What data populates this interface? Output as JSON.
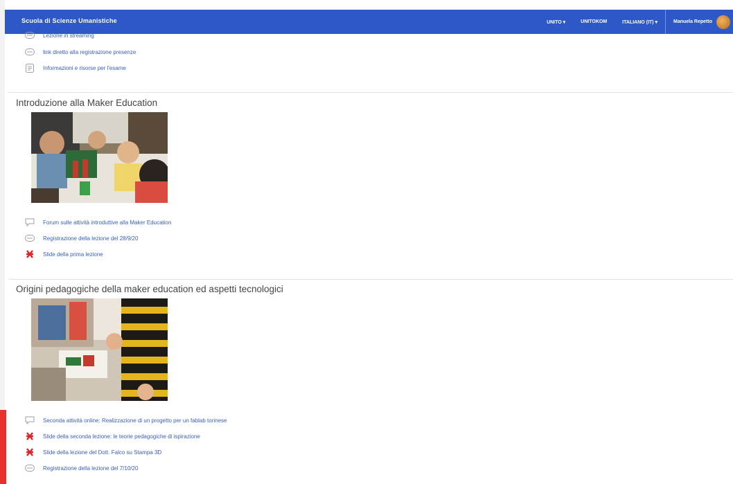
{
  "navbar": {
    "brand": "Scuola di Scienze Umanistiche",
    "menu": [
      {
        "label": "UNITO ▾"
      },
      {
        "label": "UNITOKOM"
      },
      {
        "label": "ITALIANO (IT) ▾"
      }
    ],
    "user_name": "Manuela Repetto"
  },
  "top_activities": [
    {
      "label": "Lezione in streaming",
      "icon": "url-icon"
    },
    {
      "label": "link diretto alla registrazione presenze",
      "icon": "url-icon"
    },
    {
      "label": "Informazioni e risorse per l'esame",
      "icon": "page-icon"
    }
  ],
  "sections": [
    {
      "title": "Introduzione alla Maker Education",
      "activities": [
        {
          "label": "Forum sulle attività introduttive alla Maker Education",
          "icon": "forum-icon"
        },
        {
          "label": "Registrazione della lezione del 28/9/20",
          "icon": "url-icon"
        },
        {
          "label": "Slide della prima lezione",
          "icon": "pdf-icon"
        }
      ]
    },
    {
      "title": "Origini pedagogiche della maker education ed aspetti tecnologici",
      "activities": [
        {
          "label": "Seconda attività online: Realizzazione di un progetto per un fablab torinese",
          "icon": "forum-icon"
        },
        {
          "label": "Slide della seconda lezione: le teorie pedagogiche di ispirazione",
          "icon": "pdf-icon"
        },
        {
          "label": "Slide della lezione del Dott. Falco su Stampa 3D",
          "icon": "pdf-icon"
        },
        {
          "label": "Registrazione della lezione del 7/10/20",
          "icon": "url-icon"
        }
      ]
    }
  ],
  "colors": {
    "navbar": "#2e58c8",
    "link": "#3a5ec0",
    "pdf_icon": "#d9262b",
    "side_tab": "#e5322d"
  }
}
